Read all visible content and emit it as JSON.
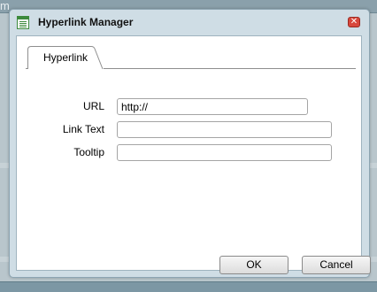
{
  "window": {
    "title": "Hyperlink Manager",
    "close_glyph": "✕"
  },
  "background": {
    "partial_text": "m"
  },
  "tabs": [
    {
      "label": "Hyperlink",
      "active": true
    }
  ],
  "form": {
    "url": {
      "label": "URL",
      "value": "http://"
    },
    "link_text": {
      "label": "Link Text",
      "value": ""
    },
    "tooltip": {
      "label": "Tooltip",
      "value": ""
    }
  },
  "buttons": {
    "ok_label": "OK",
    "cancel_label": "Cancel"
  },
  "icons": {
    "app": "hyperlink-manager-icon",
    "close": "close-icon"
  },
  "colors": {
    "dialog_frame": "#cfdde5",
    "close_button": "#d8483c",
    "icon_green": "#3d8a3d"
  }
}
